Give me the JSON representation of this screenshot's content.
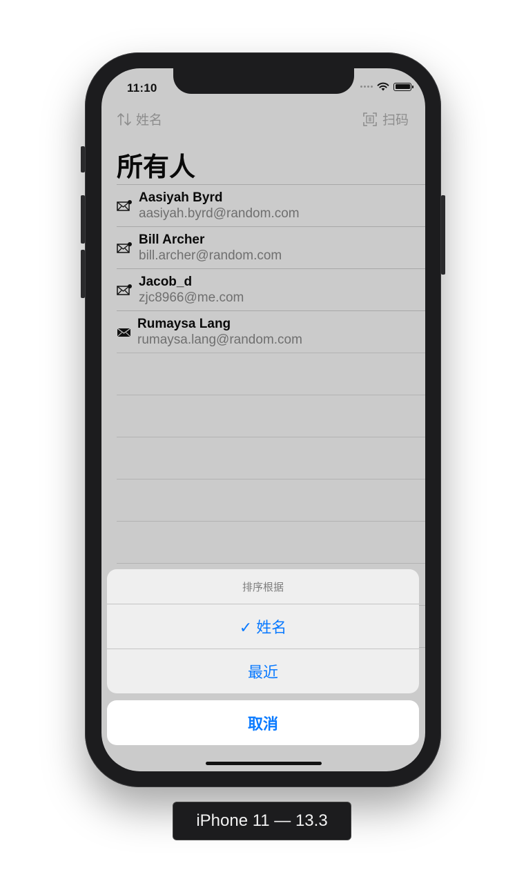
{
  "status_bar": {
    "time": "11:10"
  },
  "navbar": {
    "sort_label": "姓名",
    "scan_label": "扫码"
  },
  "page_title": "所有人",
  "contacts": [
    {
      "name": "Aasiyah Byrd",
      "email": "aasiyah.byrd@random.com",
      "icon": "envelope-unread-icon"
    },
    {
      "name": "Bill Archer",
      "email": "bill.archer@random.com",
      "icon": "envelope-unread-icon"
    },
    {
      "name": "Jacob_d",
      "email": "zjc8966@me.com",
      "icon": "envelope-unread-icon"
    },
    {
      "name": "Rumaysa Lang",
      "email": "rumaysa.lang@random.com",
      "icon": "envelope-filled-icon"
    }
  ],
  "action_sheet": {
    "title": "排序根据",
    "options": [
      {
        "label": "✓ 姓名",
        "selected": true
      },
      {
        "label": "最近",
        "selected": false
      }
    ],
    "cancel": "取消"
  },
  "device_label": "iPhone 11 — 13.3",
  "colors": {
    "accent": "#0a7aff",
    "dim_background": "#cbcbcb"
  }
}
